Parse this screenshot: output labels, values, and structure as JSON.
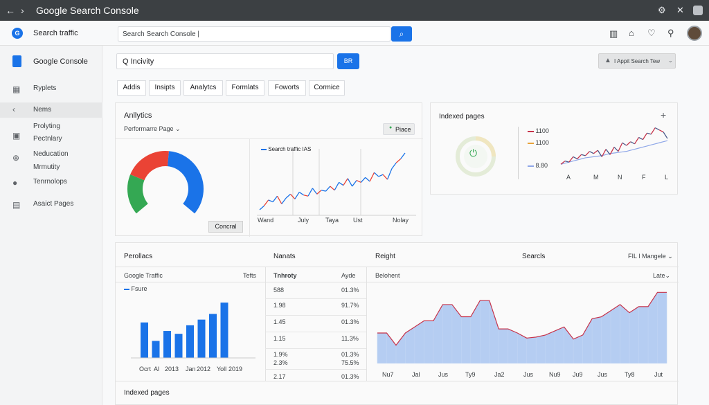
{
  "window": {
    "title": "Google Search Console",
    "back_glyph": "←",
    "fwd_glyph": "›"
  },
  "header": {
    "product": "Search traffic",
    "search_placeholder": "Search Search Console |",
    "search_btn_glyph": "⌕"
  },
  "sidebar": {
    "brand": "Google Console",
    "items": [
      {
        "label": "Ryplets",
        "icon": "grid-icon"
      },
      {
        "label": "Nems",
        "icon": "chevron-left-icon"
      },
      {
        "label": "Prolyting",
        "icon": ""
      },
      {
        "label": "Pectnlary",
        "icon": "image-icon"
      },
      {
        "label": "Neducation",
        "icon": "globe-icon"
      },
      {
        "label": "Mrmutity",
        "icon": ""
      },
      {
        "label": "Tenrnolops",
        "icon": "person-icon"
      },
      {
        "label": "Asaict Pages",
        "icon": "list-icon"
      }
    ]
  },
  "toolbar": {
    "search_value": "Q Incivity",
    "btn_label": "BR",
    "account_label": "I Appit Search Tew"
  },
  "tabs": [
    "Addis",
    "Insipts",
    "Analytcs",
    "Formlats",
    "Foworts",
    "Cormice"
  ],
  "analytics": {
    "title": "Anllytics",
    "dropdown": "Performarre Page",
    "cancel_btn": "Concral",
    "place_btn": "Piace",
    "line_legend": "Search traffic",
    "line_legend_suffix": "IAS",
    "x_ticks": [
      "Wand",
      "July",
      "Taya",
      "Ust",
      "Nolay"
    ]
  },
  "indexed_top": {
    "title": "Indexed pages",
    "add_glyph": "+",
    "legend": [
      "1100",
      "1100",
      "8.80"
    ],
    "x_ticks": [
      "A",
      "M",
      "N",
      "F",
      "L"
    ]
  },
  "bottom": {
    "col1_title": "Perollacs",
    "col2_title": "Nanats",
    "col3_title": "Reight",
    "col4_title": "Searcls",
    "filter": "FIL I Mangele",
    "google_traffic": "Google Traffic",
    "tefts": "Tefts",
    "bar_legend": "Fsure",
    "bar_x": [
      "Ocrt",
      "Al",
      "2013",
      "Jan",
      "2012",
      "Yoll",
      "2019"
    ],
    "table_h1": "Tnhroty",
    "table_h2": "Ayde",
    "rows": [
      [
        "588",
        "01.3%"
      ],
      [
        "1.98",
        "91.7%"
      ],
      [
        "1.45",
        "01.3%"
      ],
      [
        "1.15",
        "11.3%"
      ],
      [
        "1.9%",
        "01.3%"
      ],
      [
        "2.3%",
        "75.5%"
      ],
      [
        "2.17",
        "01.3%"
      ]
    ],
    "belohent": "Belohent",
    "late": "Late",
    "area_x": [
      "Nu7",
      "Jal",
      "Jus",
      "Ty9",
      "Ja2",
      "Jus",
      "Nu9",
      "Ju9",
      "Jus",
      "Ty8",
      "Jut"
    ],
    "indexed_pages": "Indexed pages"
  },
  "chart_data": [
    {
      "type": "pie",
      "title": "",
      "values": [
        48,
        24,
        28
      ],
      "colors": [
        "#1a73e8",
        "#34a853",
        "#ea4335"
      ]
    },
    {
      "type": "line",
      "series": [
        {
          "name": "Search traffic",
          "values": [
            10,
            14,
            20,
            18,
            24,
            16,
            22,
            26,
            21,
            28,
            25,
            24,
            32,
            26,
            30,
            29,
            34,
            30,
            38,
            35,
            42,
            34,
            40,
            38,
            43,
            39,
            48,
            44,
            46,
            41,
            52,
            58,
            62,
            68
          ]
        }
      ],
      "x_ticks": [
        "Wand",
        "July",
        "Taya",
        "Ust",
        "Nolay"
      ],
      "colors": [
        "#ea4335",
        "#1a73e8"
      ]
    },
    {
      "type": "line",
      "series": [
        {
          "name": "1100",
          "values": [
            20,
            26,
            24,
            34,
            30,
            38,
            36,
            44,
            40,
            46,
            34,
            48,
            38,
            52,
            44,
            60,
            55,
            62,
            58,
            70,
            66,
            78,
            76,
            88,
            84,
            80,
            68
          ]
        },
        {
          "name": "8.80",
          "values": [
            20,
            22,
            24,
            26,
            28,
            30,
            32,
            33,
            34,
            35,
            36,
            38,
            40,
            41,
            42,
            43,
            44,
            46,
            48,
            50,
            52,
            54,
            56,
            58,
            60,
            62,
            64
          ]
        }
      ],
      "x_ticks": [
        "A",
        "M",
        "N",
        "F",
        "L"
      ]
    },
    {
      "type": "bar",
      "categories": [
        "Ocrt",
        "Al",
        "2013",
        "Jan",
        "2012",
        "Yoll",
        "2019"
      ],
      "values": [
        50,
        24,
        38,
        34,
        46,
        54,
        62,
        78
      ],
      "colors": [
        "#1a73e8"
      ]
    },
    {
      "type": "area",
      "categories": [
        "Nu7",
        "Jal",
        "Jus",
        "Ty9",
        "Ja2",
        "Jus",
        "Nu9",
        "Ju9",
        "Jus",
        "Ty8",
        "Jut"
      ],
      "values": [
        30,
        30,
        18,
        30,
        36,
        42,
        42,
        58,
        58,
        46,
        46,
        62,
        62,
        34,
        34,
        30,
        25,
        26,
        28,
        32,
        36,
        24,
        28,
        44,
        46,
        52,
        58,
        50,
        56,
        56,
        70,
        70
      ],
      "colors": [
        "#a8c4f0",
        "#c7334a"
      ]
    }
  ]
}
